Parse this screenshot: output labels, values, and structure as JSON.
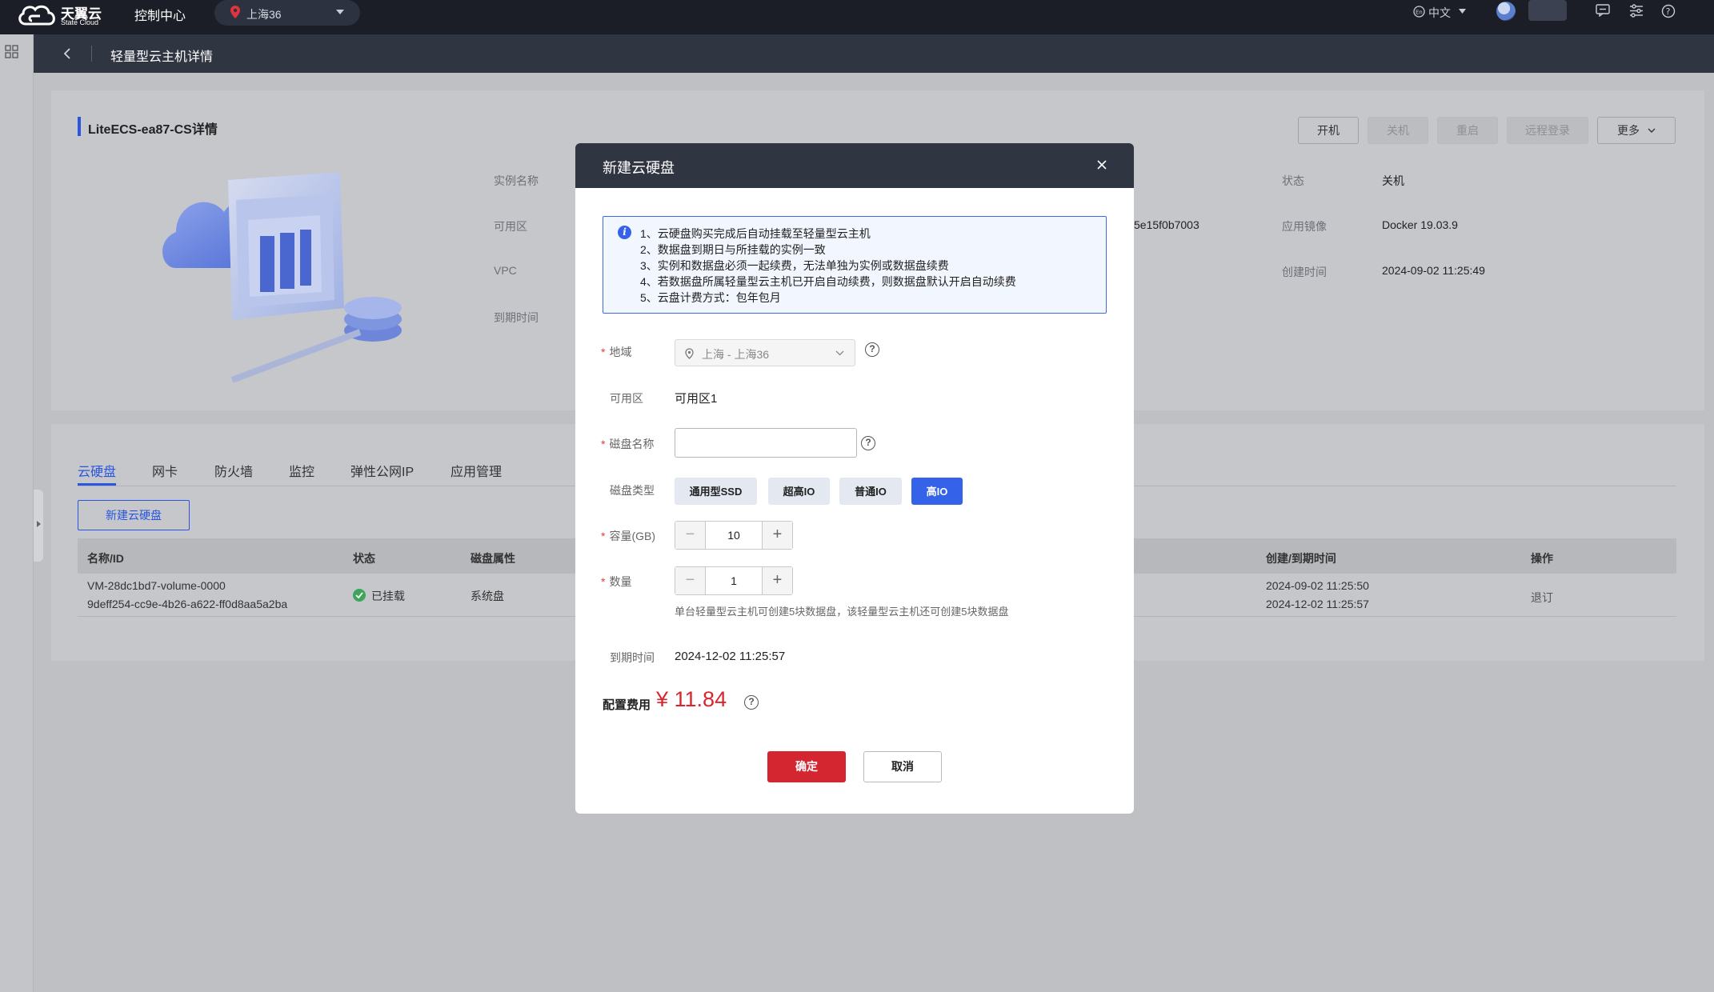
{
  "topbar": {
    "brand": "天翼云",
    "brand_sub": "State Cloud",
    "console": "控制中心",
    "region": "上海36",
    "language": "中文"
  },
  "subheader": {
    "title": "轻量型云主机详情"
  },
  "detail": {
    "title": "LiteECS-ea87-CS详情",
    "actions": {
      "start": "开机",
      "stop": "关机",
      "restart": "重启",
      "remote": "远程登录",
      "more": "更多"
    },
    "labels": {
      "name": "实例名称",
      "zone": "可用区",
      "vpc": "VPC",
      "expire": "到期时间",
      "status": "状态",
      "image": "应用镜像",
      "created": "创建时间"
    },
    "values": {
      "partial_id": "5e15f0b7003",
      "status": "关机",
      "image": "Docker 19.03.9",
      "created": "2024-09-02 11:25:49"
    }
  },
  "tabs": [
    "云硬盘",
    "网卡",
    "防火墙",
    "监控",
    "弹性公网IP",
    "应用管理"
  ],
  "disk_table": {
    "new_button": "新建云硬盘",
    "columns": {
      "name": "名称/ID",
      "status": "状态",
      "attr": "磁盘属性",
      "time": "创建/到期时间",
      "ops": "操作"
    },
    "row": {
      "name": "VM-28dc1bd7-volume-0000",
      "id": "9deff254-cc9e-4b26-a622-ff0d8aa5a2ba",
      "status": "已挂载",
      "attr": "系统盘",
      "created": "2024-09-02 11:25:50",
      "expire": "2024-12-02 11:25:57",
      "op": "退订"
    }
  },
  "modal": {
    "title": "新建云硬盘",
    "notices": [
      "1、云硬盘购买完成后自动挂载至轻量型云主机",
      "2、数据盘到期日与所挂载的实例一致",
      "3、实例和数据盘必须一起续费，无法单独为实例或数据盘续费",
      "4、若数据盘所属轻量型云主机已开启自动续费，则数据盘默认开启自动续费",
      "5、云盘计费方式：包年包月"
    ],
    "fields": {
      "region_label": "地域",
      "region_value": "上海 - 上海36",
      "zone_label": "可用区",
      "zone_value": "可用区1",
      "name_label": "磁盘名称",
      "name_value": "",
      "type_label": "磁盘类型",
      "types": [
        "通用型SSD",
        "超高IO",
        "普通IO",
        "高IO"
      ],
      "selected_type": "高IO",
      "capacity_label": "容量(GB)",
      "capacity_value": "10",
      "count_label": "数量",
      "count_value": "1",
      "count_hint": "单台轻量型云主机可创建5块数据盘，该轻量型云主机还可创建5块数据盘",
      "expire_label": "到期时间",
      "expire_value": "2024-12-02 11:25:57"
    },
    "fee_label": "配置费用",
    "fee_value": "¥ 11.84",
    "confirm": "确定",
    "cancel": "取消"
  },
  "colors": {
    "primary": "#3462e9",
    "danger": "#d32630",
    "header": "#1b1e26"
  }
}
